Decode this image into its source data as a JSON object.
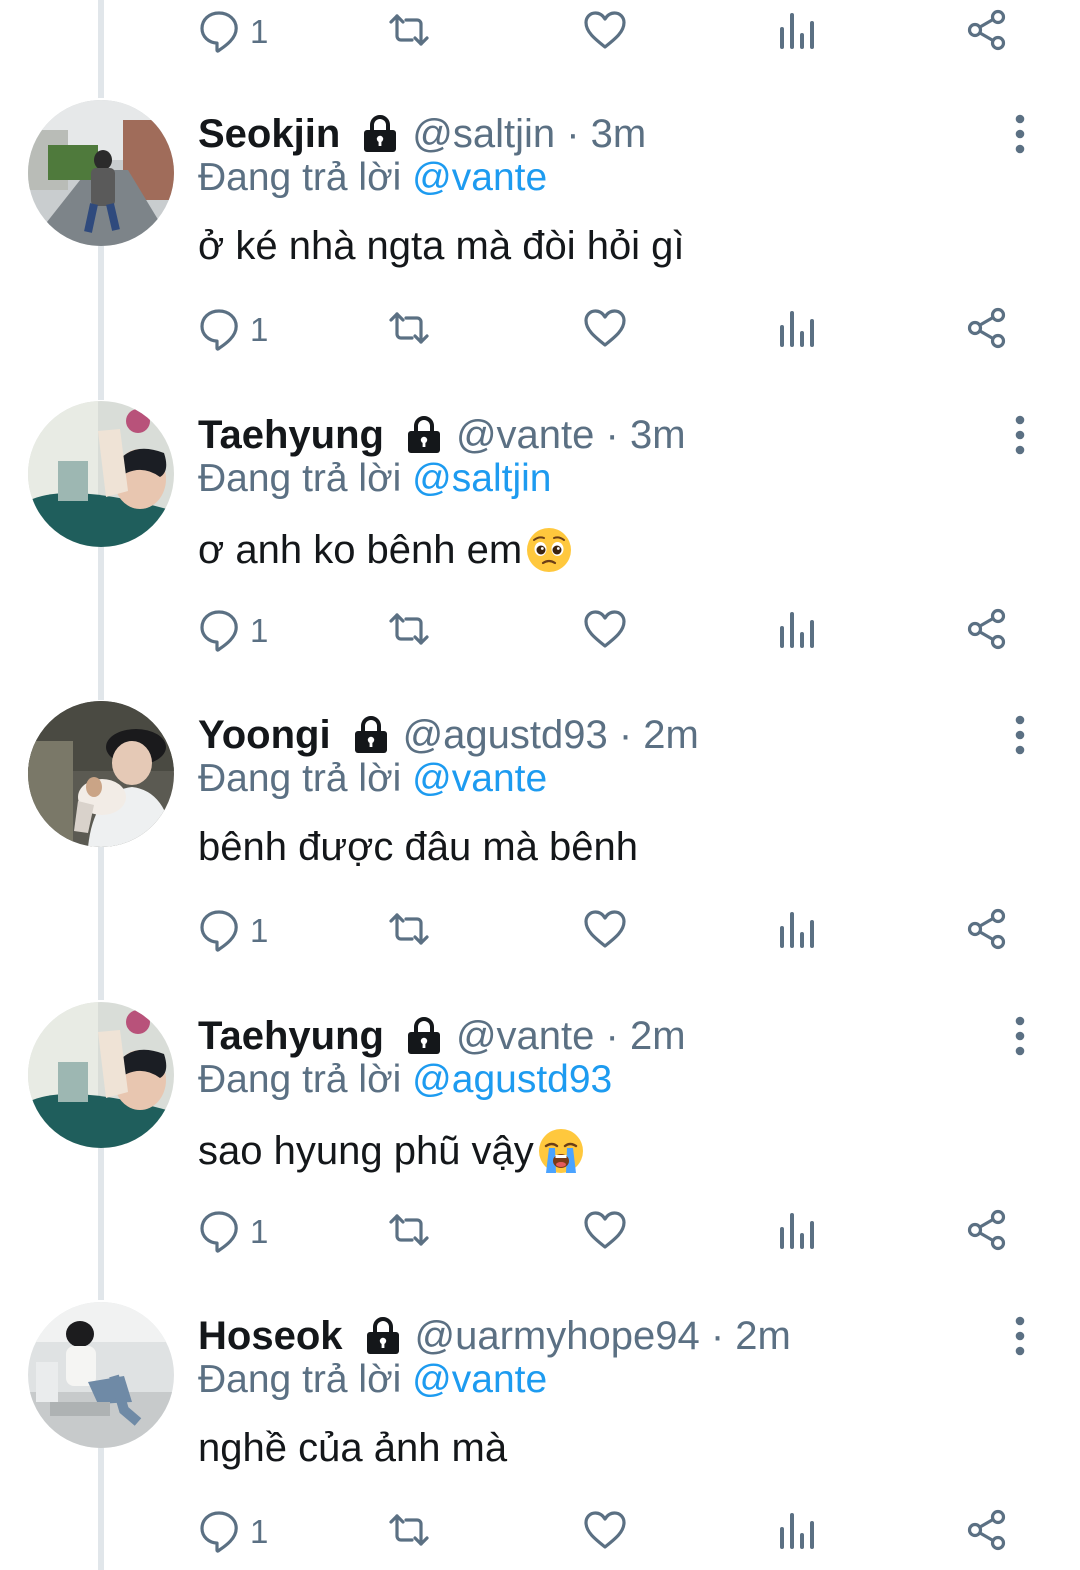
{
  "colors": {
    "name": "#14171a",
    "secondary": "#5b7083",
    "mention": "#1d9bf0",
    "thread_line": "#e1e6ea"
  },
  "top_actions": {
    "reply_count": "1"
  },
  "replying_prefix": "Đang trả lời",
  "tweets": [
    {
      "name": "Seokjin",
      "handle_time": "@saltjin · 3m",
      "reply_to": "@vante",
      "text": "ở ké nhà ngta mà đòi hỏi gì",
      "emoji": "",
      "reply_count": "1",
      "avatar": "avatar-seokjin"
    },
    {
      "name": "Taehyung",
      "handle_time": "@vante · 3m",
      "reply_to": "@saltjin",
      "text": "ơ anh ko bênh em",
      "emoji": "pleading-face",
      "reply_count": "1",
      "avatar": "avatar-taehyung"
    },
    {
      "name": "Yoongi",
      "handle_time": "@agustd93 · 2m",
      "reply_to": "@vante",
      "text": "bênh được đâu mà bênh",
      "emoji": "",
      "reply_count": "1",
      "avatar": "avatar-yoongi"
    },
    {
      "name": "Taehyung",
      "handle_time": "@vante · 2m",
      "reply_to": "@agustd93",
      "text": "sao hyung phũ vậy",
      "emoji": "loudly-crying-face",
      "reply_count": "1",
      "avatar": "avatar-taehyung"
    },
    {
      "name": "Hoseok",
      "handle_time": "@uarmyhope94 · 2m",
      "reply_to": "@vante",
      "text": "nghề của ảnh mà",
      "emoji": "",
      "reply_count": "1",
      "avatar": "avatar-hoseok"
    }
  ],
  "icons": {
    "reply": "reply-icon",
    "retweet": "retweet-icon",
    "like": "heart-icon",
    "stats": "analytics-icon",
    "share": "share-icon",
    "lock": "lock-icon",
    "more": "more-vertical-icon"
  }
}
